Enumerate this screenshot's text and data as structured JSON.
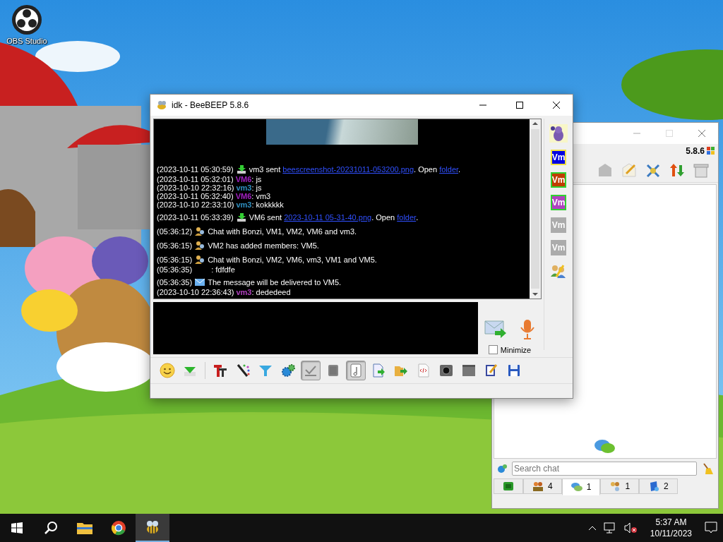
{
  "desktop_icons": [
    {
      "label": "OBS Studio"
    }
  ],
  "chat_window": {
    "title": "idk - BeeBEEP 5.8.6",
    "messages": [
      {
        "kind": "file",
        "time": "(2023-10-11 05:30:59)",
        "parts": [
          {
            "text": "vm3 sent "
          },
          {
            "link": "beescreenshot-20231011-053200.png"
          },
          {
            "text": ". Open "
          },
          {
            "link": "folder"
          },
          {
            "text": "."
          }
        ]
      },
      {
        "kind": "chat",
        "time": "(2023-10-11 05:32:01)",
        "sender": "VM6",
        "color": "#a020c0",
        "text": ": js"
      },
      {
        "kind": "chat",
        "time": "(2023-10-10 22:32:16)",
        "sender": "vm3",
        "color": "#2f8fc0",
        "text": ": js"
      },
      {
        "kind": "chat",
        "time": "(2023-10-11 05:32:40)",
        "sender": "VM6",
        "color": "#a020c0",
        "text": ": vm3"
      },
      {
        "kind": "chat",
        "time": "(2023-10-10 22:33:10)",
        "sender": "vm3",
        "color": "#2f8fc0",
        "text": ": kokkkkk"
      },
      {
        "kind": "file",
        "time": "(2023-10-11 05:33:39)",
        "parts": [
          {
            "text": "VM6 sent "
          },
          {
            "link": "2023-10-11 05-31-40.png"
          },
          {
            "text": ". Open "
          },
          {
            "link": "folder"
          },
          {
            "text": "."
          }
        ]
      },
      {
        "kind": "group",
        "time": "(05:36:12)",
        "text": "Chat with Bonzi, VM1, VM2, VM6 and vm3."
      },
      {
        "kind": "group",
        "time": "(05:36:15)",
        "text": "VM2 has added members: VM5."
      },
      {
        "kind": "group",
        "time": "(05:36:15)",
        "text": "Chat with Bonzi, VM2, VM6, vm3, VM1 and VM5."
      },
      {
        "kind": "plain",
        "time": "(05:36:35)",
        "text": ": fdfdfe"
      },
      {
        "kind": "mail",
        "time": "(05:36:35)",
        "text": "The message will be delivered to VM5."
      },
      {
        "kind": "chat",
        "time": "(2023-10-10 22:36:43)",
        "sender": "vm3",
        "color": "#b040c0",
        "text": ": dededeed"
      }
    ],
    "members": [
      {
        "kind": "bonzi"
      },
      {
        "kind": "vm",
        "label": "Vm",
        "color": "#0000e0",
        "online": true,
        "away": true
      },
      {
        "kind": "vm",
        "label": "Vm",
        "color": "#c03c00",
        "online": true,
        "away": false
      },
      {
        "kind": "vm",
        "label": "Vm",
        "color": "#b040c0",
        "online": true,
        "away": false
      },
      {
        "kind": "vm",
        "label": "Vm",
        "color": "#a0a0a0",
        "online": false,
        "away": false
      },
      {
        "kind": "vm",
        "label": "Vm",
        "color": "#a0a0a0",
        "online": false,
        "away": false
      },
      {
        "kind": "add"
      }
    ],
    "minimize": {
      "label": "Minimize",
      "checked": false
    },
    "toolbar": [
      {
        "kind": "smiley"
      },
      {
        "kind": "download"
      },
      {
        "kind": "sep"
      },
      {
        "kind": "font"
      },
      {
        "kind": "pencil"
      },
      {
        "kind": "funnel"
      },
      {
        "kind": "gears"
      },
      {
        "kind": "spell",
        "checked": true
      },
      {
        "kind": "book",
        "checked": false
      },
      {
        "kind": "note",
        "checked": true
      },
      {
        "kind": "docarrow"
      },
      {
        "kind": "folderarrow"
      },
      {
        "kind": "code"
      },
      {
        "kind": "camera"
      },
      {
        "kind": "window"
      },
      {
        "kind": "notepad"
      },
      {
        "kind": "floppy"
      }
    ]
  },
  "main_window": {
    "version": "5.8.6",
    "search": {
      "placeholder": "Search chat"
    },
    "tabs": [
      {
        "kind": "network",
        "selected": false
      },
      {
        "kind": "users",
        "count": "4",
        "selected": false
      },
      {
        "kind": "chats",
        "count": "1",
        "selected": true
      },
      {
        "kind": "groups",
        "count": "1",
        "selected": false
      },
      {
        "kind": "shares",
        "count": "2",
        "selected": false
      }
    ]
  },
  "taskbar": {
    "time": "5:37 AM",
    "date": "10/11/2023"
  }
}
